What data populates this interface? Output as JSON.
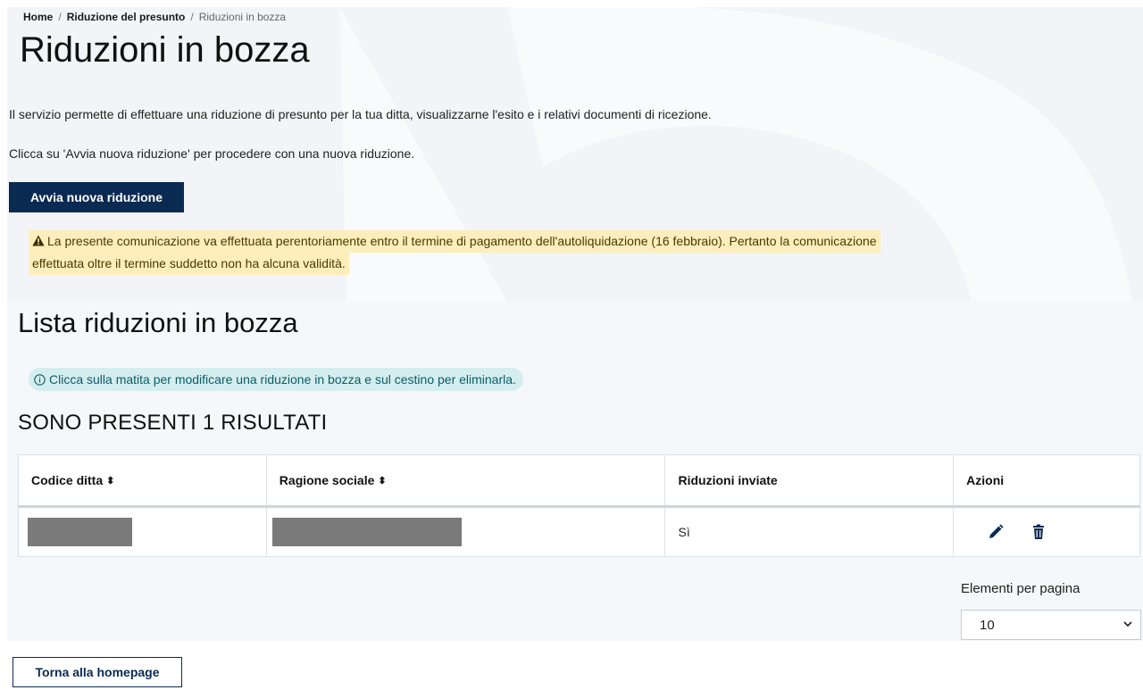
{
  "breadcrumb": {
    "home": "Home",
    "section": "Riduzione del presunto",
    "current": "Riduzioni in bozza",
    "separator": "/"
  },
  "page_title": "Riduzioni in bozza",
  "intro": {
    "line1": "Il servizio permette di effettuare una riduzione di presunto per la tua ditta, visualizzarne l'esito e i relativi documenti di ricezione.",
    "line2": "Clicca su 'Avvia nuova riduzione' per procedere con una nuova riduzione."
  },
  "new_reduction_button": "Avvia nuova riduzione",
  "warning": {
    "icon": "warning-triangle-icon",
    "line1": "La presente comunicazione va effettuata perentoriamente entro il termine di pagamento dell'autoliquidazione (16 febbraio). Pertanto la comunicazione",
    "line2": "effettuata oltre il termine suddetto non ha alcuna validità."
  },
  "list_title": "Lista riduzioni in bozza",
  "info": {
    "icon": "info-circle-icon",
    "text": "Clicca sulla matita per modificare una riduzione in bozza e sul cestino per eliminarla."
  },
  "results_count": "SONO PRESENTI 1 RISULTATI",
  "table": {
    "columns": [
      "Codice ditta",
      "Ragione sociale",
      "Riduzioni inviate",
      "Azioni"
    ],
    "sort_indicator": "⬍",
    "rows": [
      {
        "codice_ditta": "",
        "ragione_sociale": "",
        "riduzioni_inviate": "Sì",
        "actions": [
          "pencil-icon",
          "trash-icon"
        ]
      }
    ]
  },
  "pagination": {
    "label": "Elementi per pagina",
    "selected": "10"
  },
  "back_button": "Torna alla homepage",
  "colors": {
    "primary": "#0b2a52",
    "warning_bg": "#fdeebc",
    "info_bg": "#d4eef0",
    "hero_bg": "#f2f4f7"
  }
}
